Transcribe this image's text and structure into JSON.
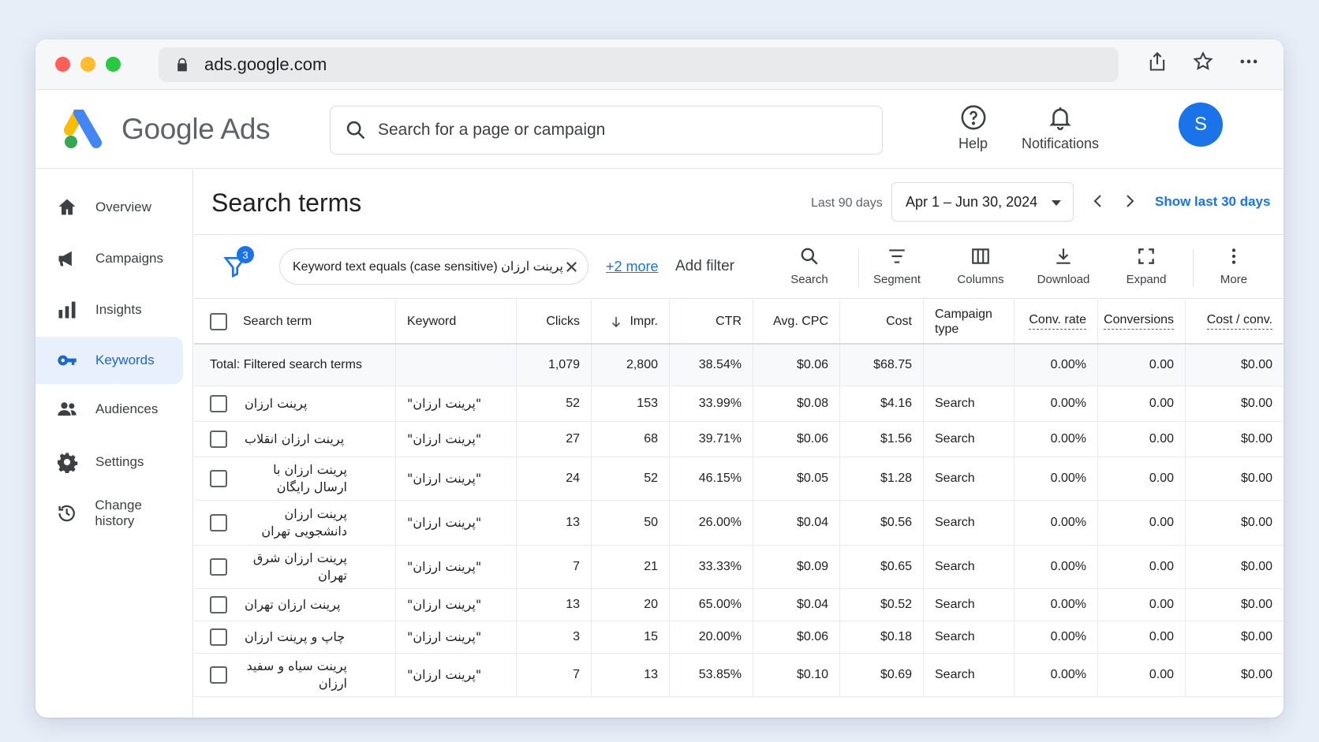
{
  "browser": {
    "url": "ads.google.com",
    "traffic_colors": [
      "#ff5f57",
      "#febc2e",
      "#28c840"
    ]
  },
  "header": {
    "brand": "Google Ads",
    "search_placeholder": "Search for a page or campaign",
    "help_label": "Help",
    "notifications_label": "Notifications",
    "avatar_initial": "S"
  },
  "sidebar": {
    "items": [
      {
        "label": "Overview",
        "icon": "home-icon"
      },
      {
        "label": "Campaigns",
        "icon": "megaphone-icon"
      },
      {
        "label": "Insights",
        "icon": "bar-chart-icon"
      },
      {
        "label": "Keywords",
        "icon": "key-icon",
        "active": true
      },
      {
        "label": "Audiences",
        "icon": "people-icon"
      },
      {
        "label": "Settings",
        "icon": "gear-icon"
      },
      {
        "label": "Change history",
        "icon": "history-icon"
      }
    ]
  },
  "main": {
    "title": "Search terms",
    "range_label": "Last 90 days",
    "date_range": "Apr 1 – Jun 30, 2024",
    "show_last": "Show last 30 days"
  },
  "filters": {
    "count": "3",
    "chip": "Keyword text equals (case sensitive) پرینت ارزان",
    "more": "+2 more",
    "add_filter": "Add filter"
  },
  "toolbar": {
    "search": "Search",
    "segment": "Segment",
    "columns": "Columns",
    "download": "Download",
    "expand": "Expand",
    "more": "More"
  },
  "table": {
    "headers": {
      "search_term": "Search term",
      "keyword": "Keyword",
      "clicks": "Clicks",
      "impr": "Impr.",
      "ctr": "CTR",
      "avg_cpc": "Avg. CPC",
      "cost": "Cost",
      "campaign_type": "Campaign type",
      "conv_rate": "Conv. rate",
      "conversions": "Conversions",
      "cost_conv": "Cost / conv."
    },
    "total": {
      "label": "Total: Filtered search terms",
      "clicks": "1,079",
      "impr": "2,800",
      "ctr": "38.54%",
      "avg_cpc": "$0.06",
      "cost": "$68.75",
      "conv_rate": "0.00%",
      "conversions": "0.00",
      "cost_conv": "$0.00"
    },
    "rows": [
      {
        "term": "پرینت ارزان",
        "keyword": "\"پرینت ارزان\"",
        "clicks": "52",
        "impr": "153",
        "ctr": "33.99%",
        "avg_cpc": "$0.08",
        "cost": "$4.16",
        "type": "Search",
        "conv_rate": "0.00%",
        "conversions": "0.00",
        "cost_conv": "$0.00"
      },
      {
        "term": "پرینت ارزان انقلاب",
        "keyword": "\"پرینت ارزان\"",
        "clicks": "27",
        "impr": "68",
        "ctr": "39.71%",
        "avg_cpc": "$0.06",
        "cost": "$1.56",
        "type": "Search",
        "conv_rate": "0.00%",
        "conversions": "0.00",
        "cost_conv": "$0.00"
      },
      {
        "term": "پرینت ارزان با ارسال رایگان",
        "keyword": "\"پرینت ارزان\"",
        "clicks": "24",
        "impr": "52",
        "ctr": "46.15%",
        "avg_cpc": "$0.05",
        "cost": "$1.28",
        "type": "Search",
        "conv_rate": "0.00%",
        "conversions": "0.00",
        "cost_conv": "$0.00"
      },
      {
        "term": "پرینت ارزان دانشجویی تهران",
        "keyword": "\"پرینت ارزان\"",
        "clicks": "13",
        "impr": "50",
        "ctr": "26.00%",
        "avg_cpc": "$0.04",
        "cost": "$0.56",
        "type": "Search",
        "conv_rate": "0.00%",
        "conversions": "0.00",
        "cost_conv": "$0.00"
      },
      {
        "term": "پرینت ارزان شرق تهران",
        "keyword": "\"پرینت ارزان\"",
        "clicks": "7",
        "impr": "21",
        "ctr": "33.33%",
        "avg_cpc": "$0.09",
        "cost": "$0.65",
        "type": "Search",
        "conv_rate": "0.00%",
        "conversions": "0.00",
        "cost_conv": "$0.00"
      },
      {
        "term": "پرینت ارزان تهران",
        "keyword": "\"پرینت ارزان\"",
        "clicks": "13",
        "impr": "20",
        "ctr": "65.00%",
        "avg_cpc": "$0.04",
        "cost": "$0.52",
        "type": "Search",
        "conv_rate": "0.00%",
        "conversions": "0.00",
        "cost_conv": "$0.00"
      },
      {
        "term": "چاپ و پرینت ارزان",
        "keyword": "\"پرینت ارزان\"",
        "clicks": "3",
        "impr": "15",
        "ctr": "20.00%",
        "avg_cpc": "$0.06",
        "cost": "$0.18",
        "type": "Search",
        "conv_rate": "0.00%",
        "conversions": "0.00",
        "cost_conv": "$0.00"
      },
      {
        "term": "پرینت سیاه و سفید ارزان",
        "keyword": "\"پرینت ارزان\"",
        "clicks": "7",
        "impr": "13",
        "ctr": "53.85%",
        "avg_cpc": "$0.10",
        "cost": "$0.69",
        "type": "Search",
        "conv_rate": "0.00%",
        "conversions": "0.00",
        "cost_conv": "$0.00"
      }
    ]
  },
  "colors": {
    "accent": "#1a73e8",
    "active_nav_bg": "#e8f0fe",
    "logo_blue": "#4285f4",
    "logo_yellow": "#fbbc04",
    "logo_green": "#34a853"
  }
}
